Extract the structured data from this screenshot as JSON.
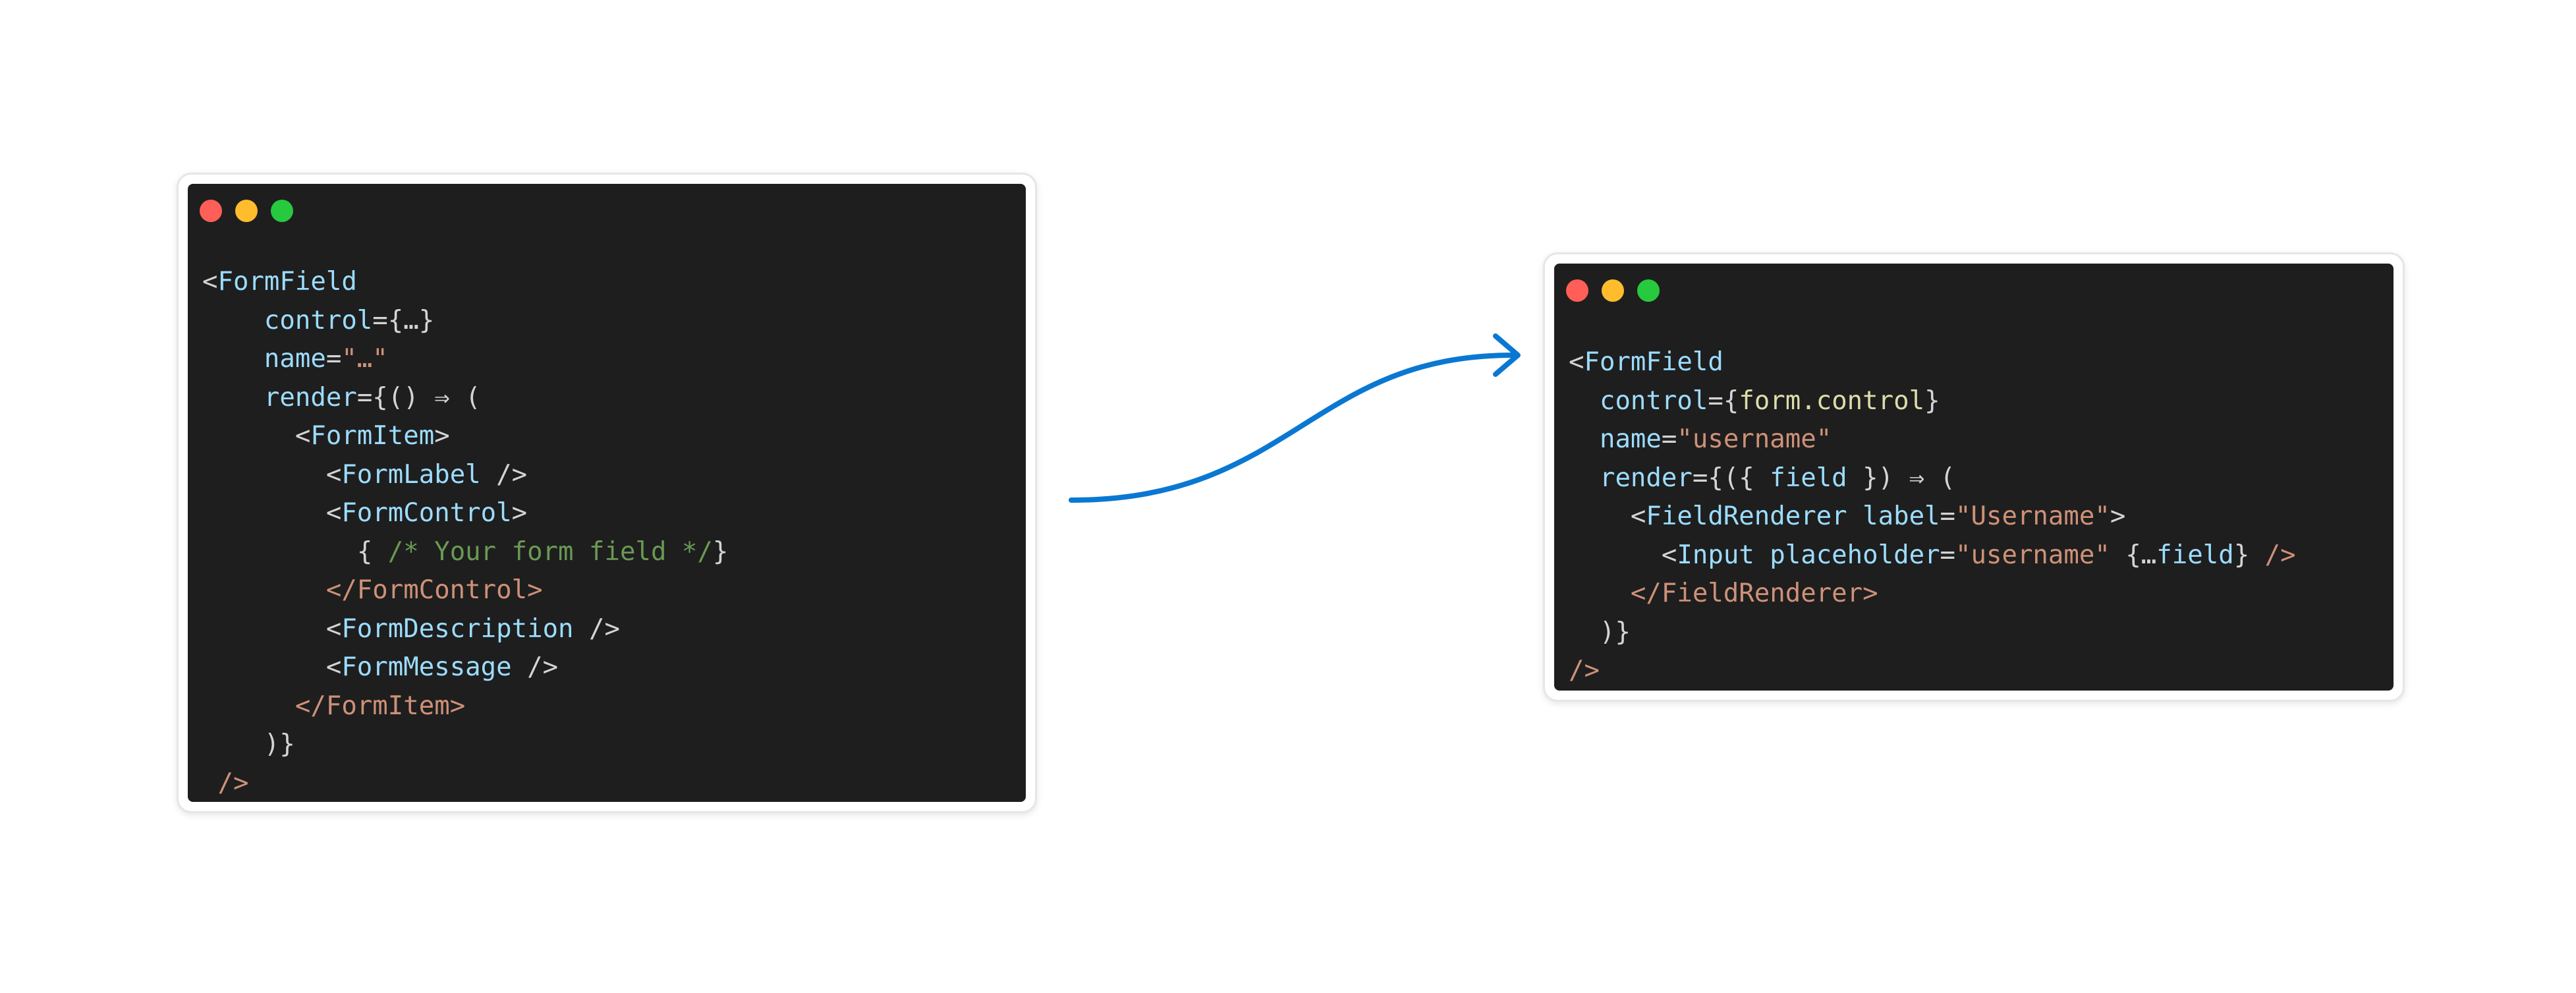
{
  "colors": {
    "code_bg": "#1e1e1e",
    "dot_close": "#ff5f56",
    "dot_minimize": "#ffbd2e",
    "dot_maximize": "#27c93f",
    "arrow": "#0a78d2"
  },
  "icons": {
    "arrow": "curved-arrow-right-icon"
  },
  "left_snippet": {
    "lines": [
      [
        {
          "t": "<",
          "c": "plain"
        },
        {
          "t": "FormField",
          "c": "tag"
        }
      ],
      [
        {
          "t": "    ",
          "c": "plain"
        },
        {
          "t": "control",
          "c": "attr"
        },
        {
          "t": "={",
          "c": "plain"
        },
        {
          "t": "…",
          "c": "plain"
        },
        {
          "t": "}",
          "c": "plain"
        }
      ],
      [
        {
          "t": "    ",
          "c": "plain"
        },
        {
          "t": "name",
          "c": "attr"
        },
        {
          "t": "=",
          "c": "plain"
        },
        {
          "t": "\"…\"",
          "c": "string"
        }
      ],
      [
        {
          "t": "    ",
          "c": "plain"
        },
        {
          "t": "render",
          "c": "attr"
        },
        {
          "t": "={() ⇒ (",
          "c": "plain"
        }
      ],
      [
        {
          "t": "      ",
          "c": "plain"
        },
        {
          "t": "<",
          "c": "plain"
        },
        {
          "t": "FormItem",
          "c": "tag"
        },
        {
          "t": ">",
          "c": "plain"
        }
      ],
      [
        {
          "t": "        ",
          "c": "plain"
        },
        {
          "t": "<",
          "c": "plain"
        },
        {
          "t": "FormLabel",
          "c": "tag"
        },
        {
          "t": " />",
          "c": "plain"
        }
      ],
      [
        {
          "t": "        ",
          "c": "plain"
        },
        {
          "t": "<",
          "c": "plain"
        },
        {
          "t": "FormControl",
          "c": "tag"
        },
        {
          "t": ">",
          "c": "plain"
        }
      ],
      [
        {
          "t": "          ",
          "c": "plain"
        },
        {
          "t": "{ ",
          "c": "plain"
        },
        {
          "t": "/* Your form field */",
          "c": "comment"
        },
        {
          "t": "}",
          "c": "plain"
        }
      ],
      [
        {
          "t": "        ",
          "c": "plain"
        },
        {
          "t": "</FormControl>",
          "c": "closing"
        }
      ],
      [
        {
          "t": "        ",
          "c": "plain"
        },
        {
          "t": "<",
          "c": "plain"
        },
        {
          "t": "FormDescription",
          "c": "tag"
        },
        {
          "t": " />",
          "c": "plain"
        }
      ],
      [
        {
          "t": "        ",
          "c": "plain"
        },
        {
          "t": "<",
          "c": "plain"
        },
        {
          "t": "FormMessage",
          "c": "tag"
        },
        {
          "t": " />",
          "c": "plain"
        }
      ],
      [
        {
          "t": "      ",
          "c": "plain"
        },
        {
          "t": "</FormItem>",
          "c": "closing"
        }
      ],
      [
        {
          "t": "    ",
          "c": "plain"
        },
        {
          "t": ")}",
          "c": "plain"
        }
      ],
      [
        {
          "t": " ",
          "c": "plain"
        },
        {
          "t": "/>",
          "c": "closing"
        }
      ]
    ]
  },
  "right_snippet": {
    "lines": [
      [
        {
          "t": "<",
          "c": "plain"
        },
        {
          "t": "FormField",
          "c": "tag"
        }
      ],
      [
        {
          "t": "  ",
          "c": "plain"
        },
        {
          "t": "control",
          "c": "attr"
        },
        {
          "t": "={",
          "c": "plain"
        },
        {
          "t": "form.control",
          "c": "prop"
        },
        {
          "t": "}",
          "c": "plain"
        }
      ],
      [
        {
          "t": "  ",
          "c": "plain"
        },
        {
          "t": "name",
          "c": "attr"
        },
        {
          "t": "=",
          "c": "plain"
        },
        {
          "t": "\"username\"",
          "c": "string"
        }
      ],
      [
        {
          "t": "  ",
          "c": "plain"
        },
        {
          "t": "render",
          "c": "attr"
        },
        {
          "t": "={({ ",
          "c": "plain"
        },
        {
          "t": "field",
          "c": "attr"
        },
        {
          "t": " }) ⇒ (",
          "c": "plain"
        }
      ],
      [
        {
          "t": "    ",
          "c": "plain"
        },
        {
          "t": "<",
          "c": "plain"
        },
        {
          "t": "FieldRenderer",
          "c": "tag"
        },
        {
          "t": " ",
          "c": "plain"
        },
        {
          "t": "label",
          "c": "attr"
        },
        {
          "t": "=",
          "c": "plain"
        },
        {
          "t": "\"Username\"",
          "c": "string"
        },
        {
          "t": ">",
          "c": "plain"
        }
      ],
      [
        {
          "t": "      ",
          "c": "plain"
        },
        {
          "t": "<",
          "c": "plain"
        },
        {
          "t": "Input",
          "c": "tag"
        },
        {
          "t": " ",
          "c": "plain"
        },
        {
          "t": "placeholder",
          "c": "attr"
        },
        {
          "t": "=",
          "c": "plain"
        },
        {
          "t": "\"username\"",
          "c": "string"
        },
        {
          "t": " {…",
          "c": "plain"
        },
        {
          "t": "field",
          "c": "attr"
        },
        {
          "t": "} ",
          "c": "plain"
        },
        {
          "t": "/>",
          "c": "closing"
        }
      ],
      [
        {
          "t": "    ",
          "c": "plain"
        },
        {
          "t": "</FieldRenderer>",
          "c": "closing"
        }
      ],
      [
        {
          "t": "  ",
          "c": "plain"
        },
        {
          "t": ")}",
          "c": "plain"
        }
      ],
      [
        {
          "t": "/>",
          "c": "closing"
        }
      ]
    ]
  }
}
